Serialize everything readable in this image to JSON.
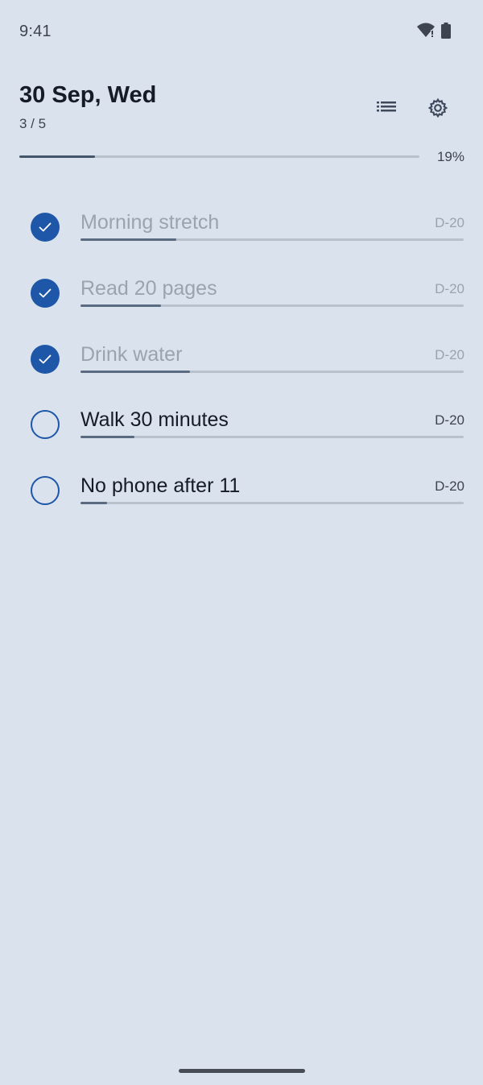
{
  "status_bar": {
    "time": "9:41",
    "icons": [
      "wifi-icon",
      "battery-icon"
    ]
  },
  "header": {
    "date": "30 Sep, Wed",
    "count": "3 / 5",
    "buttons": [
      "list-icon",
      "settings-icon"
    ]
  },
  "overall_progress": {
    "percent_label": "19%",
    "fraction": 0.19
  },
  "habits": [
    {
      "name": "Morning stretch",
      "dday": "D-20",
      "done": true,
      "progress": 0.25
    },
    {
      "name": "Read 20 pages",
      "dday": "D-20",
      "done": true,
      "progress": 0.21
    },
    {
      "name": "Drink water",
      "dday": "D-20",
      "done": true,
      "progress": 0.285
    },
    {
      "name": "Walk 30 minutes",
      "dday": "D-20",
      "done": false,
      "progress": 0.14
    },
    {
      "name": "No phone after 11",
      "dday": "D-20",
      "done": false,
      "progress": 0.07
    }
  ],
  "colors": {
    "background": "#dae2ed",
    "accent": "#1e57a8",
    "muted_text": "#9aa3ae"
  }
}
